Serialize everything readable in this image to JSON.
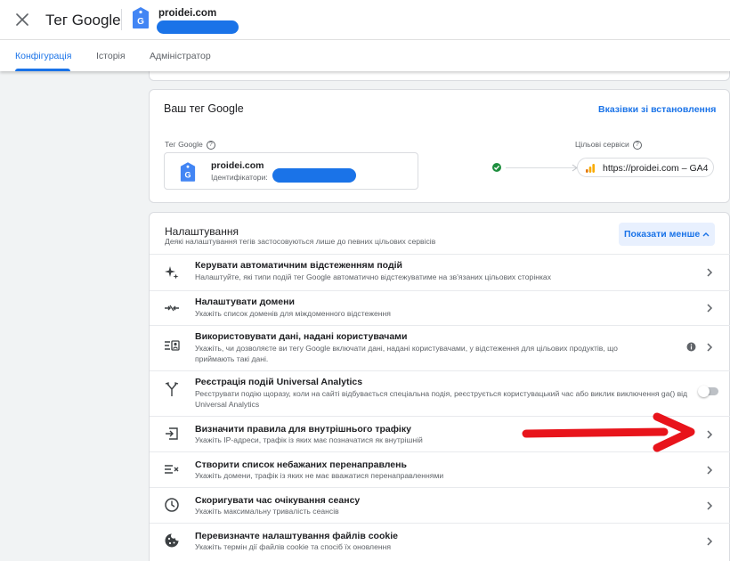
{
  "header": {
    "title": "Тег Google",
    "account": "proidei.com"
  },
  "tabs": [
    {
      "label": "Конфігурація"
    },
    {
      "label": "Історія"
    },
    {
      "label": "Адміністратор"
    }
  ],
  "your_tag": {
    "heading": "Ваш тег Google",
    "install_link": "Вказівки зі встановлення",
    "tag_label": "Тег Google",
    "tag_name": "proidei.com",
    "id_label": "Ідентифікатори:",
    "destinations_label": "Цільові сервіси",
    "destination": "https://proidei.com – GA4"
  },
  "settings": {
    "heading": "Налаштування",
    "subtitle": "Деякі налаштування тегів застосовуються лише до певних цільових сервісів",
    "toggle_button": "Показати менше",
    "items": [
      {
        "title": "Керувати автоматичним відстеженням подій",
        "desc": "Налаштуйте, які типи подій тег Google автоматично відстежуватиме на зв'язаних цільових сторінках"
      },
      {
        "title": "Налаштувати домени",
        "desc": "Укажіть список доменів для міждоменного відстеження"
      },
      {
        "title": "Використовувати дані, надані користувачами",
        "desc": "Укажіть, чи дозволяєте ви тегу Google включати дані, надані користувачами, у відстеження для цільових продуктів, що приймають такі дані."
      },
      {
        "title": "Реєстрація подій Universal Analytics",
        "desc": "Реєструвати подію щоразу, коли на сайті відбувається спеціальна подія, реєструється користувацький час або виклик виключення ga() від Universal Analytics"
      },
      {
        "title": "Визначити правила для внутрішнього трафіку",
        "desc": "Укажіть IP-адреси, трафік із яких має позначатися як внутрішній"
      },
      {
        "title": "Створити список небажаних перенаправлень",
        "desc": "Укажіть домени, трафік із яких не має вважатися перенаправленнями"
      },
      {
        "title": "Скоригувати час очікування сеансу",
        "desc": "Укажіть максимальну тривалість сеансів"
      },
      {
        "title": "Перевизначте налаштування файлів cookie",
        "desc": "Укажіть термін дії файлів cookie та спосіб їх оновлення"
      }
    ]
  },
  "colors": {
    "accent": "#1a73e8",
    "annotation_arrow": "#e8141b",
    "status_ok": "#1e8e3e",
    "ga4_orange": "#f9ab00"
  }
}
